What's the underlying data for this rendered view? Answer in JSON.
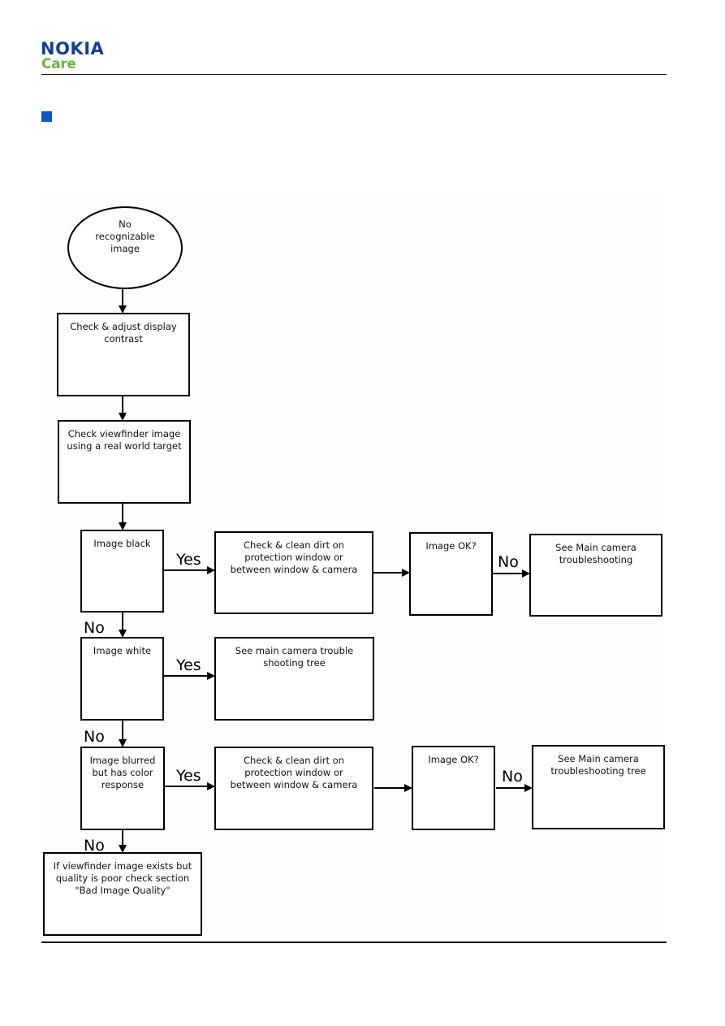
{
  "header": {
    "brand": "NOKIA",
    "sub_brand": "Care",
    "brand_color": "#124191",
    "sub_brand_color": "#6cb33f",
    "section_marker_color": "#0d5bc2"
  },
  "flowchart": {
    "nodes": [
      {
        "id": "start",
        "shape": "ellipse",
        "lines": [
          "No",
          "recognizable",
          "image"
        ]
      },
      {
        "id": "adjust-contrast",
        "shape": "rect",
        "lines": [
          "Check & adjust display",
          "contrast"
        ]
      },
      {
        "id": "check-viewfinder",
        "shape": "rect",
        "lines": [
          "Check viewfinder image",
          "using a real world target"
        ]
      },
      {
        "id": "image-black",
        "shape": "rect",
        "lines": [
          "Image black"
        ]
      },
      {
        "id": "clean-dirt-1",
        "shape": "rect",
        "lines": [
          "Check & clean dirt on",
          "protection window or",
          "between window & camera"
        ]
      },
      {
        "id": "image-ok-1",
        "shape": "rect",
        "lines": [
          "Image OK?"
        ]
      },
      {
        "id": "main-camera-1",
        "shape": "rect",
        "lines": [
          "See Main camera",
          "troubleshooting"
        ]
      },
      {
        "id": "image-white",
        "shape": "rect",
        "lines": [
          "Image white"
        ]
      },
      {
        "id": "main-camera-tree-2",
        "shape": "rect",
        "lines": [
          "See main camera trouble",
          "shooting tree"
        ]
      },
      {
        "id": "image-blurred",
        "shape": "rect",
        "lines": [
          "Image blurred",
          "but has color",
          "response"
        ]
      },
      {
        "id": "clean-dirt-2",
        "shape": "rect",
        "lines": [
          "Check & clean dirt on",
          "protection window or",
          "between window & camera"
        ]
      },
      {
        "id": "image-ok-2",
        "shape": "rect",
        "lines": [
          "Image OK?"
        ]
      },
      {
        "id": "main-camera-tree-3",
        "shape": "rect",
        "lines": [
          "See Main camera",
          "troubleshooting tree"
        ]
      },
      {
        "id": "bad-quality",
        "shape": "rect",
        "lines": [
          "If viewfinder image exists but",
          "quality is poor check section",
          "\"Bad Image Quality\""
        ]
      }
    ],
    "edges": [
      {
        "from": "start",
        "to": "adjust-contrast",
        "label": ""
      },
      {
        "from": "adjust-contrast",
        "to": "check-viewfinder",
        "label": ""
      },
      {
        "from": "check-viewfinder",
        "to": "image-black",
        "label": ""
      },
      {
        "from": "image-black",
        "to": "clean-dirt-1",
        "label": "Yes"
      },
      {
        "from": "clean-dirt-1",
        "to": "image-ok-1",
        "label": ""
      },
      {
        "from": "image-ok-1",
        "to": "main-camera-1",
        "label": "No"
      },
      {
        "from": "image-black",
        "to": "image-white",
        "label": "No"
      },
      {
        "from": "image-white",
        "to": "main-camera-tree-2",
        "label": "Yes"
      },
      {
        "from": "image-white",
        "to": "image-blurred",
        "label": "No"
      },
      {
        "from": "image-blurred",
        "to": "clean-dirt-2",
        "label": "Yes"
      },
      {
        "from": "clean-dirt-2",
        "to": "image-ok-2",
        "label": ""
      },
      {
        "from": "image-ok-2",
        "to": "main-camera-tree-3",
        "label": "No"
      },
      {
        "from": "image-blurred",
        "to": "bad-quality",
        "label": "No"
      }
    ]
  }
}
